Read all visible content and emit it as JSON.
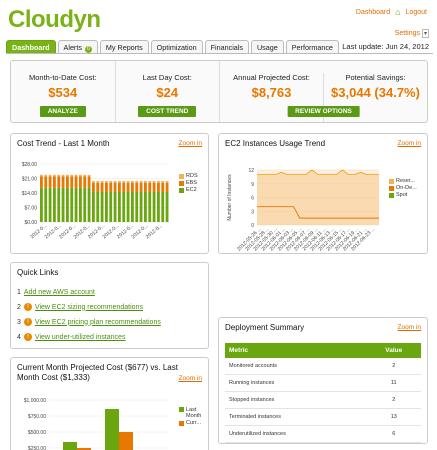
{
  "app": {
    "logo": "Cloudyn"
  },
  "toplinks": {
    "dashboard": "Dashboard",
    "logout": "Logout"
  },
  "settings": {
    "label": "Settings"
  },
  "tabs": [
    {
      "label": "Dashboard",
      "active": true
    },
    {
      "label": "Alerts",
      "badge": "0"
    },
    {
      "label": "My Reports"
    },
    {
      "label": "Optimization"
    },
    {
      "label": "Financials"
    },
    {
      "label": "Usage"
    },
    {
      "label": "Performance"
    }
  ],
  "last_update": "Last update: Jun 24, 2012",
  "kpis": [
    {
      "label": "Month-to-Date Cost:",
      "value": "$534",
      "button": "ANALYZE"
    },
    {
      "label": "Last Day Cost:",
      "value": "$24",
      "button": "COST TREND"
    },
    {
      "label": "Annual Projected Cost:",
      "value": "$8,763",
      "button": "REVIEW OPTIONS"
    },
    {
      "label": "Potential Savings:",
      "value": "$3,044 (34.7%)",
      "button": ""
    }
  ],
  "cost_trend": {
    "title": "Cost Trend - Last 1 Month",
    "zoom": "Zoom in",
    "chart_data": {
      "type": "bar",
      "stacked": true,
      "yticks": [
        "$0.00",
        "$7.00",
        "$14.00",
        "$21.00",
        "$28.00"
      ],
      "ylim": [
        0,
        28
      ],
      "series": [
        {
          "name": "RDS",
          "color": "#f5b15a"
        },
        {
          "name": "EBS",
          "color": "#e77800"
        },
        {
          "name": "EC2",
          "color": "#6aa60f"
        }
      ],
      "xtick_labels": [
        "2012-0...",
        "2012-0...",
        "2012-0...",
        "2012-0...",
        "2012-0...",
        "2012-0...",
        "2012-0...",
        "2012-0...",
        "2012-0..."
      ]
    }
  },
  "ec2_usage": {
    "title": "EC2 Instances Usage Trend",
    "zoom": "Zoom in",
    "chart_data": {
      "type": "area",
      "ylabel": "Number of Instances",
      "yticks": [
        "0",
        "3",
        "6",
        "9",
        "12"
      ],
      "ylim": [
        0,
        12
      ],
      "series": [
        {
          "name": "Reser...",
          "color": "#f5b15a"
        },
        {
          "name": "On-De...",
          "color": "#e77800"
        },
        {
          "name": "Spot",
          "color": "#6aa60f"
        }
      ],
      "xtick_labels": [
        "2012-05-26 ...",
        "2012-05-28 ...",
        "2012-05-30 ...",
        "2012-06-01 ...",
        "2012-06-03 ...",
        "2012-06-05 ...",
        "2012-06-07 ...",
        "2012-06-09 ...",
        "2012-06-11 ...",
        "2012-06-13 ...",
        "2012-06-15 ...",
        "2012-06-17 ...",
        "2012-06-19 ...",
        "2012-06-21 ...",
        "2012-06-23 ..."
      ]
    }
  },
  "quick_links": {
    "title": "Quick Links",
    "items": [
      {
        "num": "1",
        "label": "Add new AWS account",
        "icon": "number"
      },
      {
        "num": "2",
        "label": "View EC2 sizing recommendations",
        "icon": "alert-icon"
      },
      {
        "num": "3",
        "label": "View EC2 pricing plan recommendations",
        "icon": "alert-icon"
      },
      {
        "num": "4",
        "label": "View under-utilized instances",
        "icon": "alert-icon"
      }
    ]
  },
  "deployment_summary": {
    "title": "Deployment Summary",
    "zoom": "Zoom in",
    "headers": [
      "Metric",
      "Value"
    ],
    "rows": [
      {
        "metric": "Monitored accounts",
        "value": "2"
      },
      {
        "metric": "Running instances",
        "value": "11"
      },
      {
        "metric": "Stopped instances",
        "value": "2"
      },
      {
        "metric": "Terminated instances",
        "value": "13"
      },
      {
        "metric": "Underutilized instances",
        "value": "6"
      }
    ]
  },
  "projected_cost": {
    "title": "Current Month Projected Cost ($677) vs. Last Month Cost ($1,333)",
    "zoom": "Zoom in",
    "chart_data": {
      "type": "bar",
      "yticks": [
        "$1,000.00",
        "$750.00",
        "$500.00",
        "$250.00"
      ],
      "series": [
        {
          "name": "Last Month",
          "color": "#6aa60f"
        },
        {
          "name": "Curr...",
          "color": "#e77800"
        }
      ]
    }
  }
}
